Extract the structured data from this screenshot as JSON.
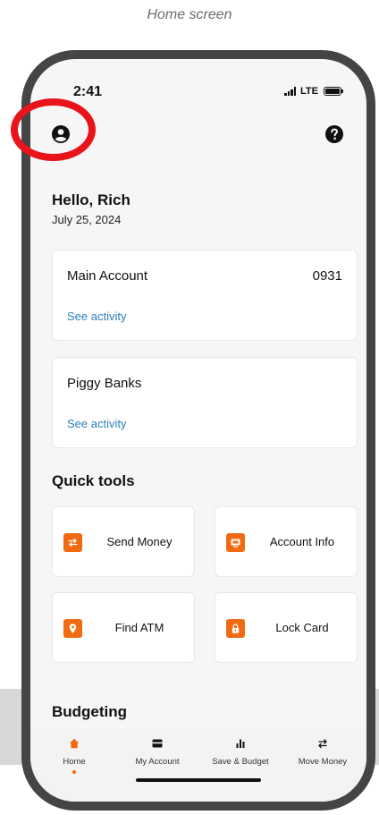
{
  "caption": "Home screen",
  "status_bar": {
    "time": "2:41",
    "network": "LTE"
  },
  "header": {
    "profile_icon": "user-circle-icon",
    "help_icon": "help-circle-icon"
  },
  "greeting": "Hello, Rich",
  "date": "July 25, 2024",
  "accounts": [
    {
      "title": "Main Account",
      "number": "0931",
      "link": "See activity"
    },
    {
      "title": "Piggy Banks",
      "link": "See activity"
    }
  ],
  "quick_tools": {
    "heading": "Quick tools",
    "items": [
      {
        "label": "Send Money",
        "icon": "transfer-arrows-icon"
      },
      {
        "label": "Account Info",
        "icon": "account-card-icon"
      },
      {
        "label": "Find ATM",
        "icon": "location-pin-icon"
      },
      {
        "label": "Lock Card",
        "icon": "lock-icon"
      }
    ]
  },
  "budgeting": {
    "heading": "Budgeting"
  },
  "tabbar": {
    "items": [
      {
        "label": "Home",
        "icon": "home-icon",
        "active": true
      },
      {
        "label": "My Account",
        "icon": "card-icon",
        "active": false
      },
      {
        "label": "Save & Budget",
        "icon": "bar-chart-icon",
        "active": false
      },
      {
        "label": "Move Money",
        "icon": "transfer-arrows-icon",
        "active": false
      }
    ]
  },
  "colors": {
    "accent": "#f06a12",
    "link": "#2a7fb9",
    "annotation": "#e8141a",
    "frame": "#454545"
  }
}
